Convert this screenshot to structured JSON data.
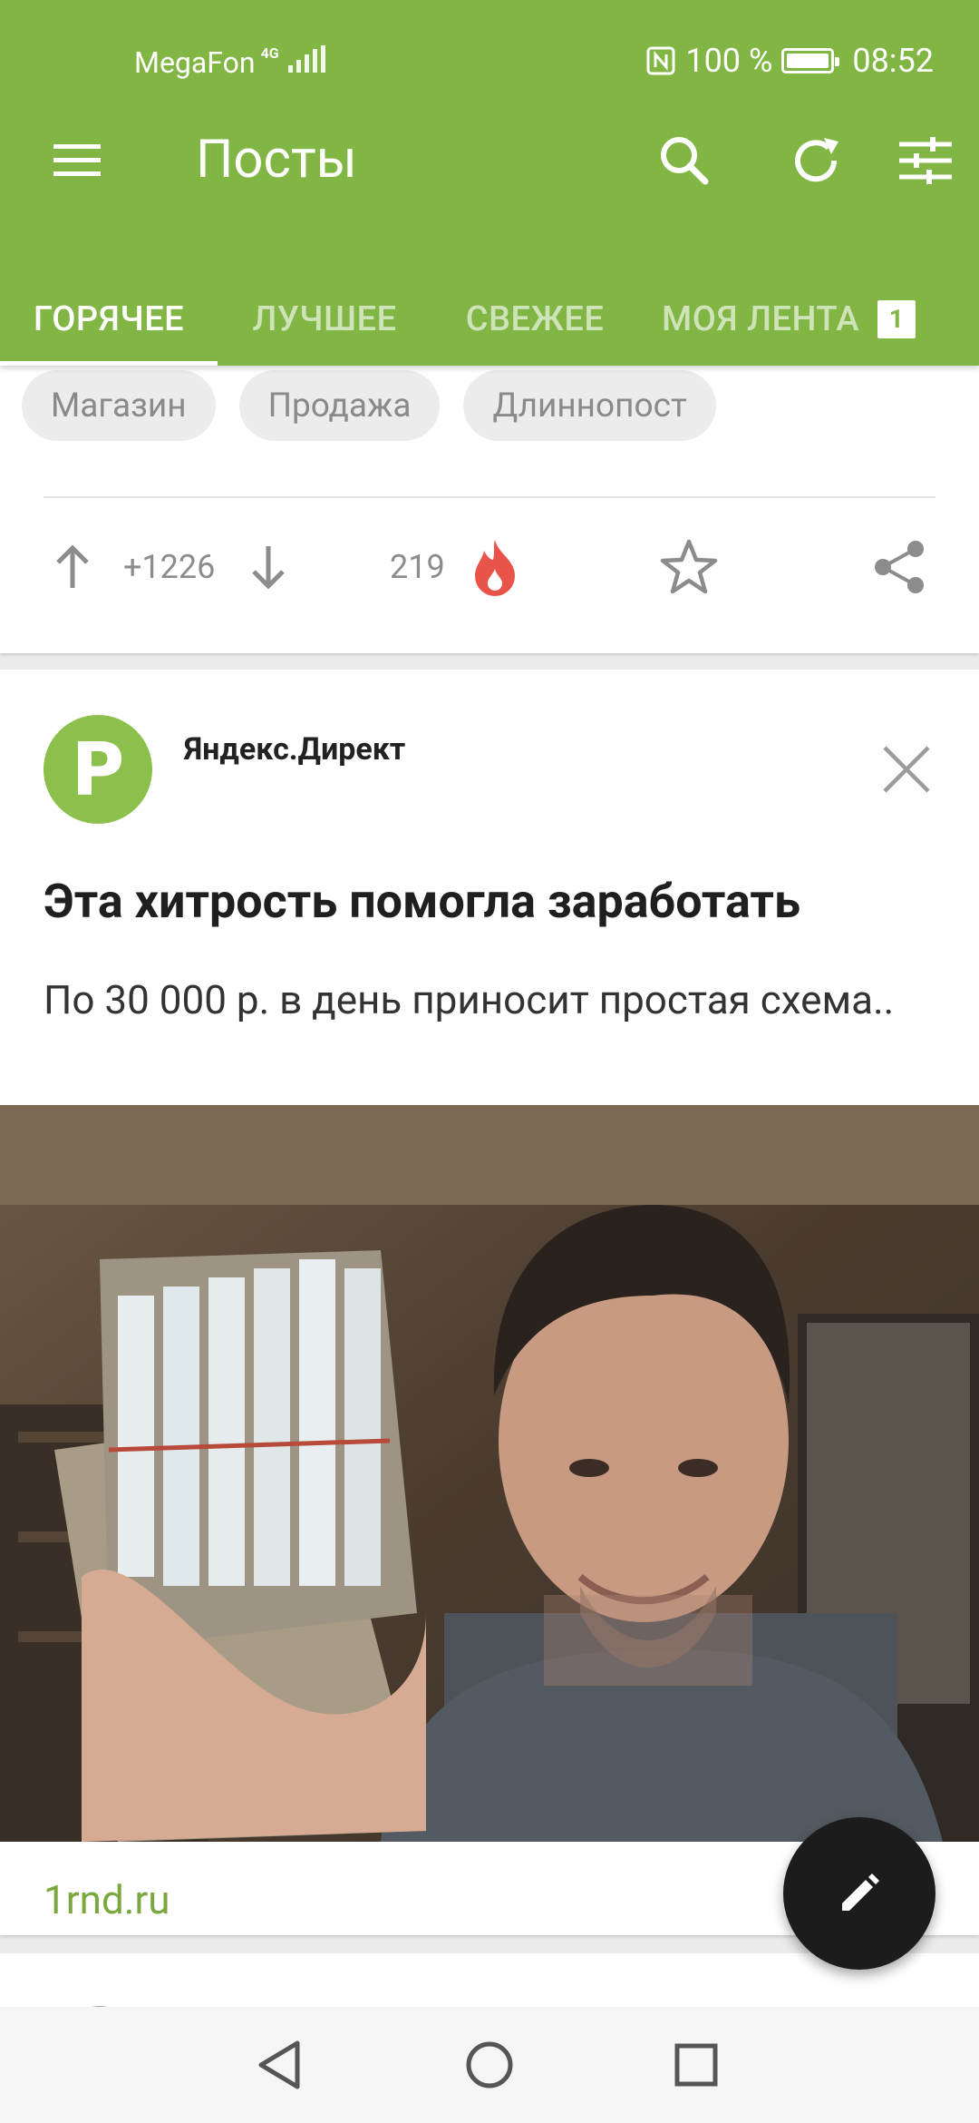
{
  "status_bar": {
    "carrier": "MegaFon",
    "network_type": "4G",
    "battery_text": "100 %",
    "time": "08:52"
  },
  "toolbar": {
    "title": "Посты",
    "icons": [
      "menu-icon",
      "search-icon",
      "refresh-icon",
      "filter-sliders-icon"
    ]
  },
  "tabs": [
    {
      "label": "ГОРЯЧЕЕ",
      "active": true
    },
    {
      "label": "ЛУЧШЕЕ",
      "active": false
    },
    {
      "label": "СВЕЖЕЕ",
      "active": false
    },
    {
      "label": "МОЯ ЛЕНТА",
      "active": false,
      "badge": "1"
    }
  ],
  "post": {
    "tags": [
      "Магазин",
      "Продажа",
      "Длиннопост"
    ],
    "rating": "+1226",
    "comments": "219"
  },
  "ad": {
    "avatar_letter": "P",
    "sponsor": "Яндекс.Директ",
    "title": "Эта хитрость помогла заработать",
    "text": "По 30 000 р. в день приносит простая схема..",
    "link": "1rnd.ru",
    "image_desc": "Мужчина держит пачку денег"
  },
  "colors": {
    "accent": "#81b544",
    "link": "#7aa83f",
    "fire": "#e8534a",
    "fab": "#1c1c1c"
  }
}
